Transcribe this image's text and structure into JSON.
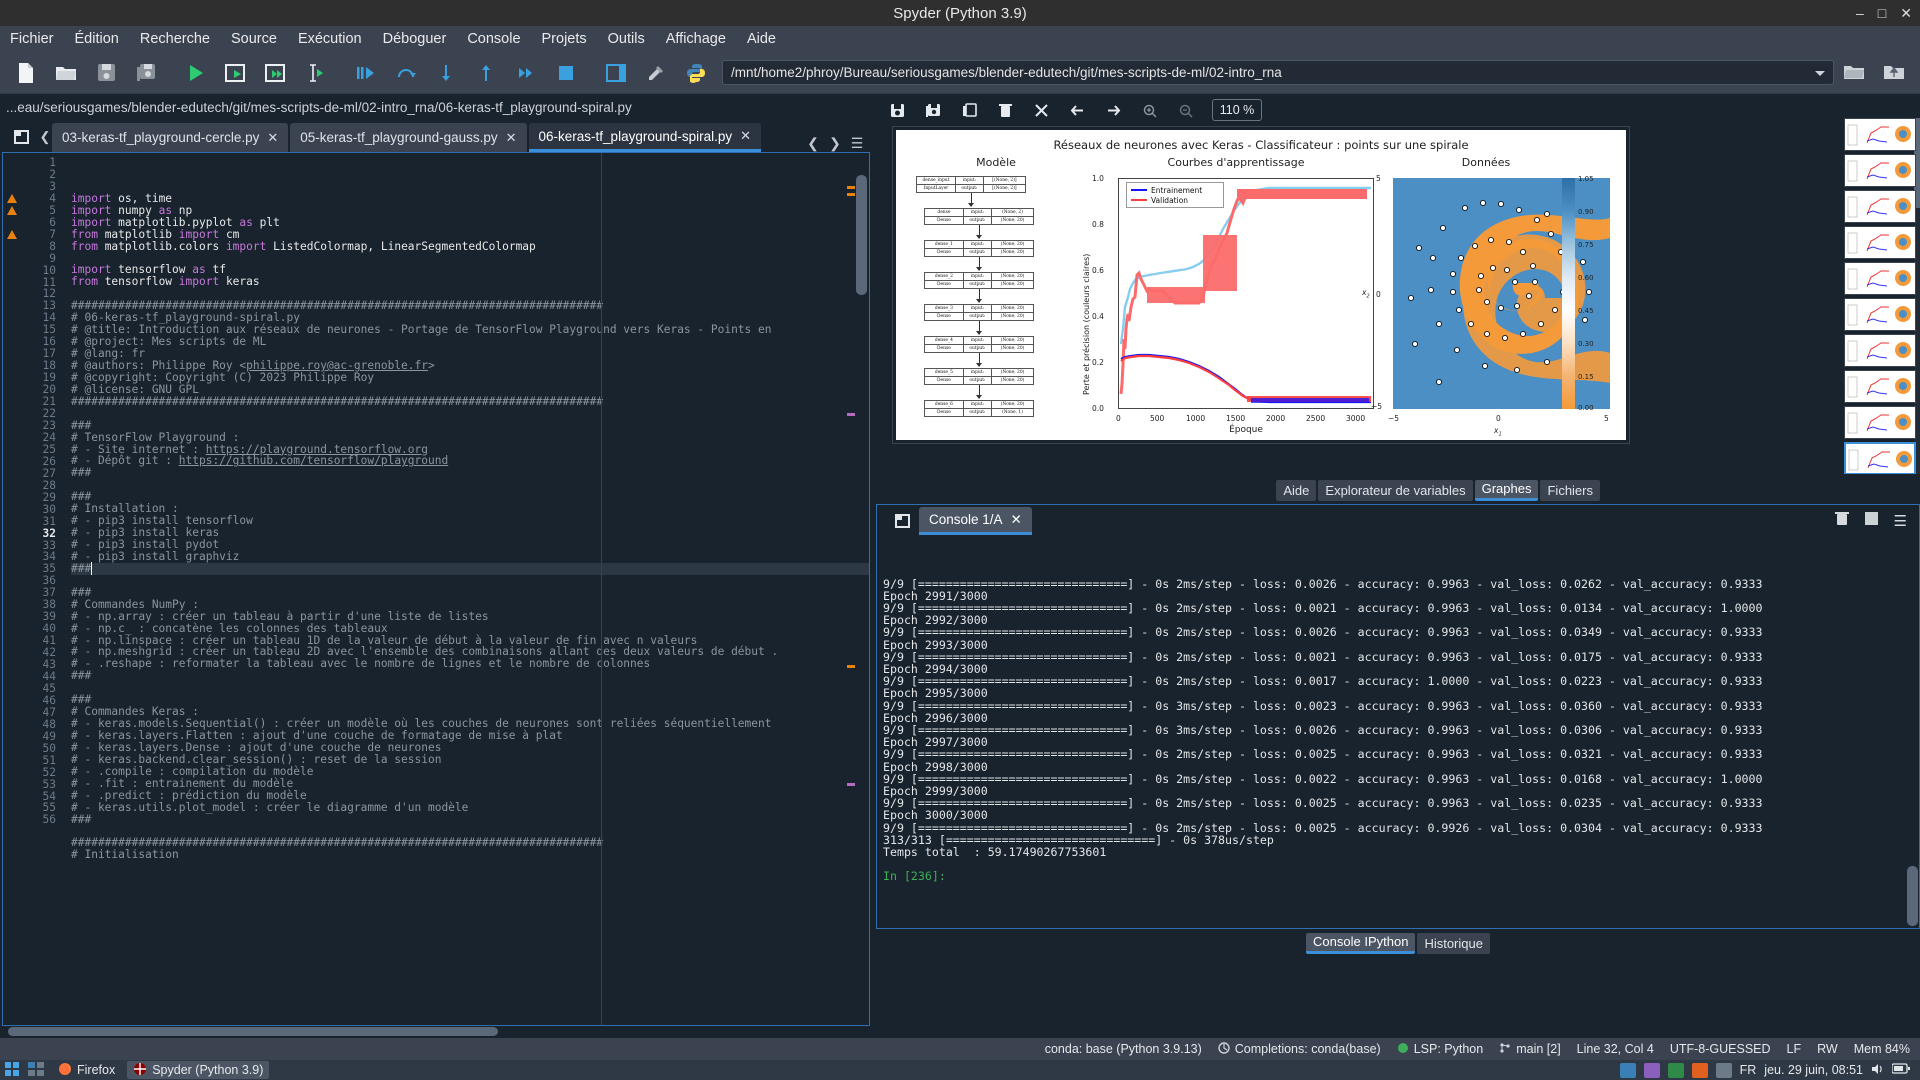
{
  "window": {
    "title": "Spyder (Python 3.9)",
    "minimize": "minimize-icon",
    "maximize": "maximize-icon",
    "close": "close-icon"
  },
  "menubar": {
    "items": [
      "Fichier",
      "Édition",
      "Recherche",
      "Source",
      "Exécution",
      "Déboguer",
      "Console",
      "Projets",
      "Outils",
      "Affichage",
      "Aide"
    ]
  },
  "toolbar": {
    "buttons": [
      "new-file-icon",
      "open-file-icon",
      "save-file-icon",
      "save-all-icon",
      "run-file-icon",
      "run-cell-icon",
      "run-cell-advance-icon",
      "run-selection-icon",
      "debug-icon",
      "step-over-icon",
      "step-into-icon",
      "step-out-icon",
      "continue-icon",
      "stop-icon",
      "pane-layout-icon",
      "preferences-icon",
      "python-path-icon"
    ],
    "path_value": "/mnt/home2/phroy/Bureau/seriousgames/blender-edutech/git/mes-scripts-de-ml/02-intro_rna",
    "open_folder_icon": "open-folder-icon",
    "up_folder_icon": "up-folder-icon"
  },
  "editor": {
    "breadcrumb": "...eau/seriousgames/blender-edutech/git/mes-scripts-de-ml/02-intro_rna/06-keras-tf_playground-spiral.py",
    "browse_icon": "browse-tabs-icon",
    "prev_icon": "chevron-left-icon",
    "next_icon": "chevron-right-icon",
    "options_icon": "hamburger-options-icon",
    "tabs": [
      {
        "label": "03-keras-tf_playground-cercle.py",
        "active": false
      },
      {
        "label": "05-keras-tf_playground-gauss.py",
        "active": false
      },
      {
        "label": "06-keras-tf_playground-spiral.py",
        "active": true
      }
    ],
    "current_line": 32,
    "warning_lines": [
      4,
      5,
      7
    ],
    "lines": [
      {
        "n": 1,
        "html": "<span class='kw'>import</span> os, time"
      },
      {
        "n": 2,
        "html": "<span class='kw'>import</span> numpy <span class='kw'>as</span> np"
      },
      {
        "n": 3,
        "html": "<span class='kw'>import</span> matplotlib.pyplot <span class='kw'>as</span> plt"
      },
      {
        "n": 4,
        "html": "<span class='kw'>from</span> matplotlib <span class='kw'>import</span> cm"
      },
      {
        "n": 5,
        "html": "<span class='kw'>from</span> matplotlib.colors <span class='kw'>import</span> ListedColormap, LinearSegmentedColormap"
      },
      {
        "n": 6,
        "html": ""
      },
      {
        "n": 7,
        "html": "<span class='kw'>import</span> tensorflow <span class='kw'>as</span> tf"
      },
      {
        "n": 8,
        "html": "<span class='kw'>from</span> tensorflow <span class='kw'>import</span> keras"
      },
      {
        "n": 9,
        "html": ""
      },
      {
        "n": 10,
        "html": "<span class='cm'>###############################################################################</span>"
      },
      {
        "n": 11,
        "html": "<span class='cm'># 06-keras-tf_playground-spiral.py</span>"
      },
      {
        "n": 12,
        "html": "<span class='cm'># @title: Introduction aux réseaux de neurones - Portage de TensorFlow Playground vers Keras - Points en</span>"
      },
      {
        "n": 13,
        "html": "<span class='cm'># @project: Mes scripts de ML</span>"
      },
      {
        "n": 14,
        "html": "<span class='cm'># @lang: fr</span>"
      },
      {
        "n": 15,
        "html": "<span class='cm'># @authors: Philippe Roy &lt;</span><span class='lnk'>philippe.roy@ac-grenoble.fr</span><span class='cm'>&gt;</span>"
      },
      {
        "n": 16,
        "html": "<span class='cm'># @copyright: Copyright (C) 2023 Philippe Roy</span>"
      },
      {
        "n": 17,
        "html": "<span class='cm'># @license: GNU GPL</span>"
      },
      {
        "n": 18,
        "html": "<span class='cm'>###############################################################################</span>"
      },
      {
        "n": 19,
        "html": ""
      },
      {
        "n": 20,
        "html": "<span class='cm'>###</span>"
      },
      {
        "n": 21,
        "html": "<span class='cm'># TensorFlow Playground :</span>"
      },
      {
        "n": 22,
        "html": "<span class='cm'># - Site internet : </span><span class='lnk'>https://playground.tensorflow.org</span>"
      },
      {
        "n": 23,
        "html": "<span class='cm'># - Dépôt git : </span><span class='lnk'>https://github.com/tensorflow/playground</span>"
      },
      {
        "n": 24,
        "html": "<span class='cm'>###</span>"
      },
      {
        "n": 25,
        "html": ""
      },
      {
        "n": 26,
        "html": "<span class='cm'>###</span>"
      },
      {
        "n": 27,
        "html": "<span class='cm'># Installation :</span>"
      },
      {
        "n": 28,
        "html": "<span class='cm'># - pip3 install tensorflow</span>"
      },
      {
        "n": 29,
        "html": "<span class='cm'># - pip3 install keras</span>"
      },
      {
        "n": 30,
        "html": "<span class='cm'># - pip3 install pydot</span>"
      },
      {
        "n": 31,
        "html": "<span class='cm'># - pip3 install graphviz</span>"
      },
      {
        "n": 32,
        "html": "<span class='cm'>###</span>"
      },
      {
        "n": 33,
        "html": ""
      },
      {
        "n": 34,
        "html": "<span class='cm'>###</span>"
      },
      {
        "n": 35,
        "html": "<span class='cm'># Commandes NumPy :</span>"
      },
      {
        "n": 36,
        "html": "<span class='cm'># - np.array : créer un tableau à partir d'une liste de listes</span>"
      },
      {
        "n": 37,
        "html": "<span class='cm'># - np.c_ : concatène les colonnes des tableaux</span>"
      },
      {
        "n": 38,
        "html": "<span class='cm'># - np.linspace : créer un tableau 1D de la valeur de début à la valeur de fin avec n valeurs</span>"
      },
      {
        "n": 39,
        "html": "<span class='cm'># - np.meshgrid : créer un tableau 2D avec l'ensemble des combinaisons allant des deux valeurs de début .</span>"
      },
      {
        "n": 40,
        "html": "<span class='cm'># - .reshape : reformater la tableau avec le nombre de lignes et le nombre de colonnes</span>"
      },
      {
        "n": 41,
        "html": "<span class='cm'>###</span>"
      },
      {
        "n": 42,
        "html": ""
      },
      {
        "n": 43,
        "html": "<span class='cm'>###</span>"
      },
      {
        "n": 44,
        "html": "<span class='cm'># Commandes Keras :</span>"
      },
      {
        "n": 45,
        "html": "<span class='cm'># - keras.models.Sequential() : créer un modèle où les couches de neurones sont reliées séquentiellement</span>"
      },
      {
        "n": 46,
        "html": "<span class='cm'># - keras.layers.Flatten : ajout d'une couche de formatage de mise à plat</span>"
      },
      {
        "n": 47,
        "html": "<span class='cm'># - keras.layers.Dense : ajout d'une couche de neurones</span>"
      },
      {
        "n": 48,
        "html": "<span class='cm'># - keras.backend.clear_session() : reset de la session</span>"
      },
      {
        "n": 49,
        "html": "<span class='cm'># - .compile : compilation du modèle</span>"
      },
      {
        "n": 50,
        "html": "<span class='cm'># - .fit : entrainement du modèle</span>"
      },
      {
        "n": 51,
        "html": "<span class='cm'># - .predict : prédiction du modèle</span>"
      },
      {
        "n": 52,
        "html": "<span class='cm'># - keras.utils.plot_model : créer le diagramme d'un modèle</span>"
      },
      {
        "n": 53,
        "html": "<span class='cm'>###</span>"
      },
      {
        "n": 54,
        "html": ""
      },
      {
        "n": 55,
        "html": "<span class='cm'>###############################################################################</span>"
      },
      {
        "n": 56,
        "html": "<span class='cm'># Initialisation</span>"
      }
    ]
  },
  "plots": {
    "toolbar": {
      "buttons": [
        "save-plot-icon",
        "save-all-plots-icon",
        "copy-plot-icon",
        "delete-plot-icon",
        "delete-all-plots-icon",
        "previous-plot-icon",
        "next-plot-icon",
        "zoom-in-icon",
        "zoom-out-icon"
      ],
      "zoom_level": "110 %"
    },
    "thumbnail_count": 10,
    "selected_thumbnail": 9
  },
  "chart_data": {
    "type": "line",
    "title": "Réseaux de neurones avec Keras - Classificateur : points sur une spirale",
    "panels": [
      {
        "name": "model",
        "title": "Modèle",
        "type": "diagram",
        "nodes": [
          {
            "name": "dense_input",
            "kind": "InputLayer",
            "input": "[(None, 2)]",
            "output": "[(None, 2)]"
          },
          {
            "name": "dense",
            "kind": "Dense",
            "input": "(None, 2)",
            "output": "(None, 20)"
          },
          {
            "name": "dense_1",
            "kind": "Dense",
            "input": "(None, 20)",
            "output": "(None, 20)"
          },
          {
            "name": "dense_2",
            "kind": "Dense",
            "input": "(None, 20)",
            "output": "(None, 20)"
          },
          {
            "name": "dense_3",
            "kind": "Dense",
            "input": "(None, 20)",
            "output": "(None, 20)"
          },
          {
            "name": "dense_4",
            "kind": "Dense",
            "input": "(None, 20)",
            "output": "(None, 20)"
          },
          {
            "name": "dense_5",
            "kind": "Dense",
            "input": "(None, 20)",
            "output": "(None, 20)"
          },
          {
            "name": "dense_6",
            "kind": "Dense",
            "input": "(None, 20)",
            "output": "(None, 1)"
          }
        ],
        "labels": {
          "input": "input:",
          "output": "output:"
        }
      },
      {
        "name": "learning-curves",
        "title": "Courbes d'apprentissage",
        "type": "line",
        "xlabel": "Époque",
        "ylabel": "Perte et précision (couleurs claires)",
        "xlim": [
          0,
          3000
        ],
        "ylim": [
          0.0,
          1.05
        ],
        "xticks": [
          0,
          500,
          1000,
          1500,
          2000,
          2500,
          3000
        ],
        "yticks": [
          "0.0",
          "0.2",
          "0.4",
          "0.6",
          "0.8",
          "1.0"
        ],
        "legend": [
          {
            "name": "Entrainement",
            "color": "#1414ff"
          },
          {
            "name": "Validation",
            "color": "#fc3d3d"
          }
        ],
        "series": [
          {
            "name": "perte entrainement",
            "color": "#1414ff",
            "note": "décroît de ~0.25 vers ~0.00"
          },
          {
            "name": "perte validation",
            "color": "#fc3d3d",
            "note": "décroît de ~0.25 vers ~0.02"
          },
          {
            "name": "précision entrainement",
            "color": "#87cdf0",
            "note": "monte de ~0.5 à ~1.0"
          },
          {
            "name": "précision validation",
            "color": "#fc6b6b",
            "note": "monte en paliers de ~0.35 à ~1.0"
          }
        ]
      },
      {
        "name": "donnees",
        "title": "Données",
        "type": "scatter",
        "xlabel": "x₁",
        "ylabel": "x₂",
        "xlim": [
          -5,
          5
        ],
        "ylim": [
          -5,
          5
        ],
        "xticks": [
          "−5",
          "0",
          "5"
        ],
        "yticks": [
          "−5",
          "0",
          "5"
        ],
        "colorbar_ticks": [
          "1.05",
          "0.90",
          "0.75",
          "0.60",
          "0.45",
          "0.30",
          "0.15",
          "0.00"
        ],
        "colors": {
          "class_a": "#f49a3a",
          "class_b": "#4b8fc4"
        }
      }
    ]
  },
  "pane_tabs": [
    {
      "label": "Aide",
      "active": false
    },
    {
      "label": "Explorateur de variables",
      "active": false
    },
    {
      "label": "Graphes",
      "active": true
    },
    {
      "label": "Fichiers",
      "active": false
    }
  ],
  "console": {
    "browse_icon": "browse-consoles-icon",
    "tab_label": "Console 1/A",
    "tab_close": "close-icon",
    "right_icons": [
      "trash-icon",
      "stop-icon",
      "hamburger-options-icon"
    ],
    "lines": [
      "9/9 [==============================] - 0s 2ms/step - loss: 0.0026 - accuracy: 0.9963 - val_loss: 0.0262 - val_accuracy: 0.9333",
      "Epoch 2991/3000",
      "9/9 [==============================] - 0s 2ms/step - loss: 0.0021 - accuracy: 0.9963 - val_loss: 0.0134 - val_accuracy: 1.0000",
      "Epoch 2992/3000",
      "9/9 [==============================] - 0s 2ms/step - loss: 0.0026 - accuracy: 0.9963 - val_loss: 0.0349 - val_accuracy: 0.9333",
      "Epoch 2993/3000",
      "9/9 [==============================] - 0s 2ms/step - loss: 0.0021 - accuracy: 0.9963 - val_loss: 0.0175 - val_accuracy: 0.9333",
      "Epoch 2994/3000",
      "9/9 [==============================] - 0s 2ms/step - loss: 0.0017 - accuracy: 1.0000 - val_loss: 0.0223 - val_accuracy: 0.9333",
      "Epoch 2995/3000",
      "9/9 [==============================] - 0s 3ms/step - loss: 0.0023 - accuracy: 0.9963 - val_loss: 0.0360 - val_accuracy: 0.9333",
      "Epoch 2996/3000",
      "9/9 [==============================] - 0s 3ms/step - loss: 0.0026 - accuracy: 0.9963 - val_loss: 0.0306 - val_accuracy: 0.9333",
      "Epoch 2997/3000",
      "9/9 [==============================] - 0s 2ms/step - loss: 0.0025 - accuracy: 0.9963 - val_loss: 0.0321 - val_accuracy: 0.9333",
      "Epoch 2998/3000",
      "9/9 [==============================] - 0s 2ms/step - loss: 0.0022 - accuracy: 0.9963 - val_loss: 0.0168 - val_accuracy: 1.0000",
      "Epoch 2999/3000",
      "9/9 [==============================] - 0s 2ms/step - loss: 0.0025 - accuracy: 0.9963 - val_loss: 0.0235 - val_accuracy: 0.9333",
      "Epoch 3000/3000",
      "9/9 [==============================] - 0s 2ms/step - loss: 0.0025 - accuracy: 0.9926 - val_loss: 0.0304 - val_accuracy: 0.9333",
      "313/313 [==============================] - 0s 378us/step",
      "Temps total  : 59.17490267753601"
    ],
    "prompt": "In [236]:"
  },
  "console_tabs": [
    {
      "label": "Console IPython",
      "active": true
    },
    {
      "label": "Historique",
      "active": false
    }
  ],
  "statusbar": {
    "conda_env": "conda: base (Python 3.9.13)",
    "completions": "Completions: conda(base)",
    "lsp": "LSP: Python",
    "branch": "main [2]",
    "cursor": "Line 32, Col 4",
    "encoding": "UTF-8-GUESSED",
    "eol": "LF",
    "rw": "RW",
    "memory": "Mem 84%",
    "git_icon": "git-branch-icon",
    "completions_icon": "completions-icon",
    "lsp_icon": "lsp-icon"
  },
  "taskbar": {
    "items": [
      {
        "label": "Firefox",
        "icon": "firefox-icon",
        "active": false
      },
      {
        "label": "Spyder (Python 3.9)",
        "icon": "spyder-icon",
        "active": true
      }
    ],
    "start_icon": "start-menu-icon",
    "tray": [
      "network-icon",
      "battery-icon",
      "volume-icon"
    ],
    "lang": "FR",
    "clock": "jeu. 29 juin, 08:51"
  },
  "colors": {
    "accent": "#3a8fd8",
    "chrome": "#3b4351",
    "editor_bg": "#19232d",
    "warning": "#e8820c",
    "prompt_green": "#3fae5a"
  }
}
